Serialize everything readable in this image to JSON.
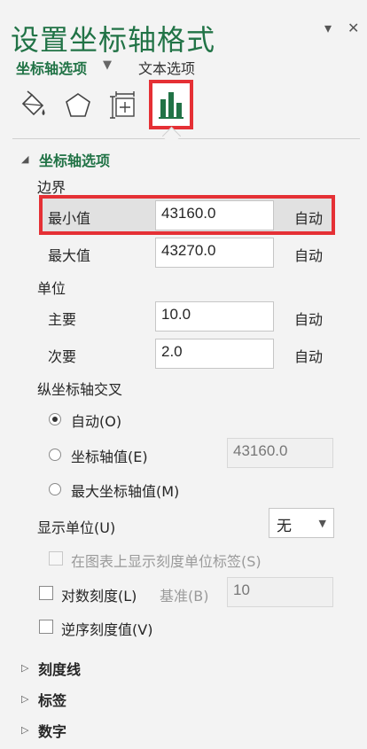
{
  "pane": {
    "title": "设置坐标轴格式",
    "dropdown_icon": "▾",
    "close_icon": "✕"
  },
  "tabs": [
    {
      "label": "坐标轴选项",
      "active": true,
      "caret": "▼"
    },
    {
      "label": "文本选项",
      "active": false
    }
  ],
  "icon_tabs": [
    "fill-line-icon",
    "effects-pentagon-icon",
    "size-properties-icon",
    "axis-options-bar-chart-icon"
  ],
  "accent_color": "#217346",
  "highlight_color": "#e53035",
  "section": {
    "title": "坐标轴选项",
    "bounds": {
      "label": "边界",
      "min": {
        "label": "最小值",
        "value": "43160.0",
        "auto": "自动"
      },
      "max": {
        "label": "最大值",
        "value": "43270.0",
        "auto": "自动"
      }
    },
    "units": {
      "label": "单位",
      "major": {
        "label": "主要",
        "value": "10.0",
        "auto": "自动"
      },
      "minor": {
        "label": "次要",
        "value": "2.0",
        "auto": "自动"
      }
    },
    "crosses": {
      "label": "纵坐标轴交叉",
      "options": [
        {
          "label": "自动(O)",
          "selected": true
        },
        {
          "label": "坐标轴值(E)",
          "selected": false,
          "value": "43160.0"
        },
        {
          "label": "最大坐标轴值(M)",
          "selected": false
        }
      ]
    },
    "display_units": {
      "label": "显示单位(U)",
      "value": "无"
    },
    "show_units_label": {
      "label": "在图表上显示刻度单位标签(S)"
    },
    "log_scale": {
      "label": "对数刻度(L)",
      "base_label": "基准(B)",
      "base_value": "10"
    },
    "reverse": {
      "label": "逆序刻度值(V)"
    }
  },
  "collapsed_sections": [
    "刻度线",
    "标签",
    "数字"
  ]
}
